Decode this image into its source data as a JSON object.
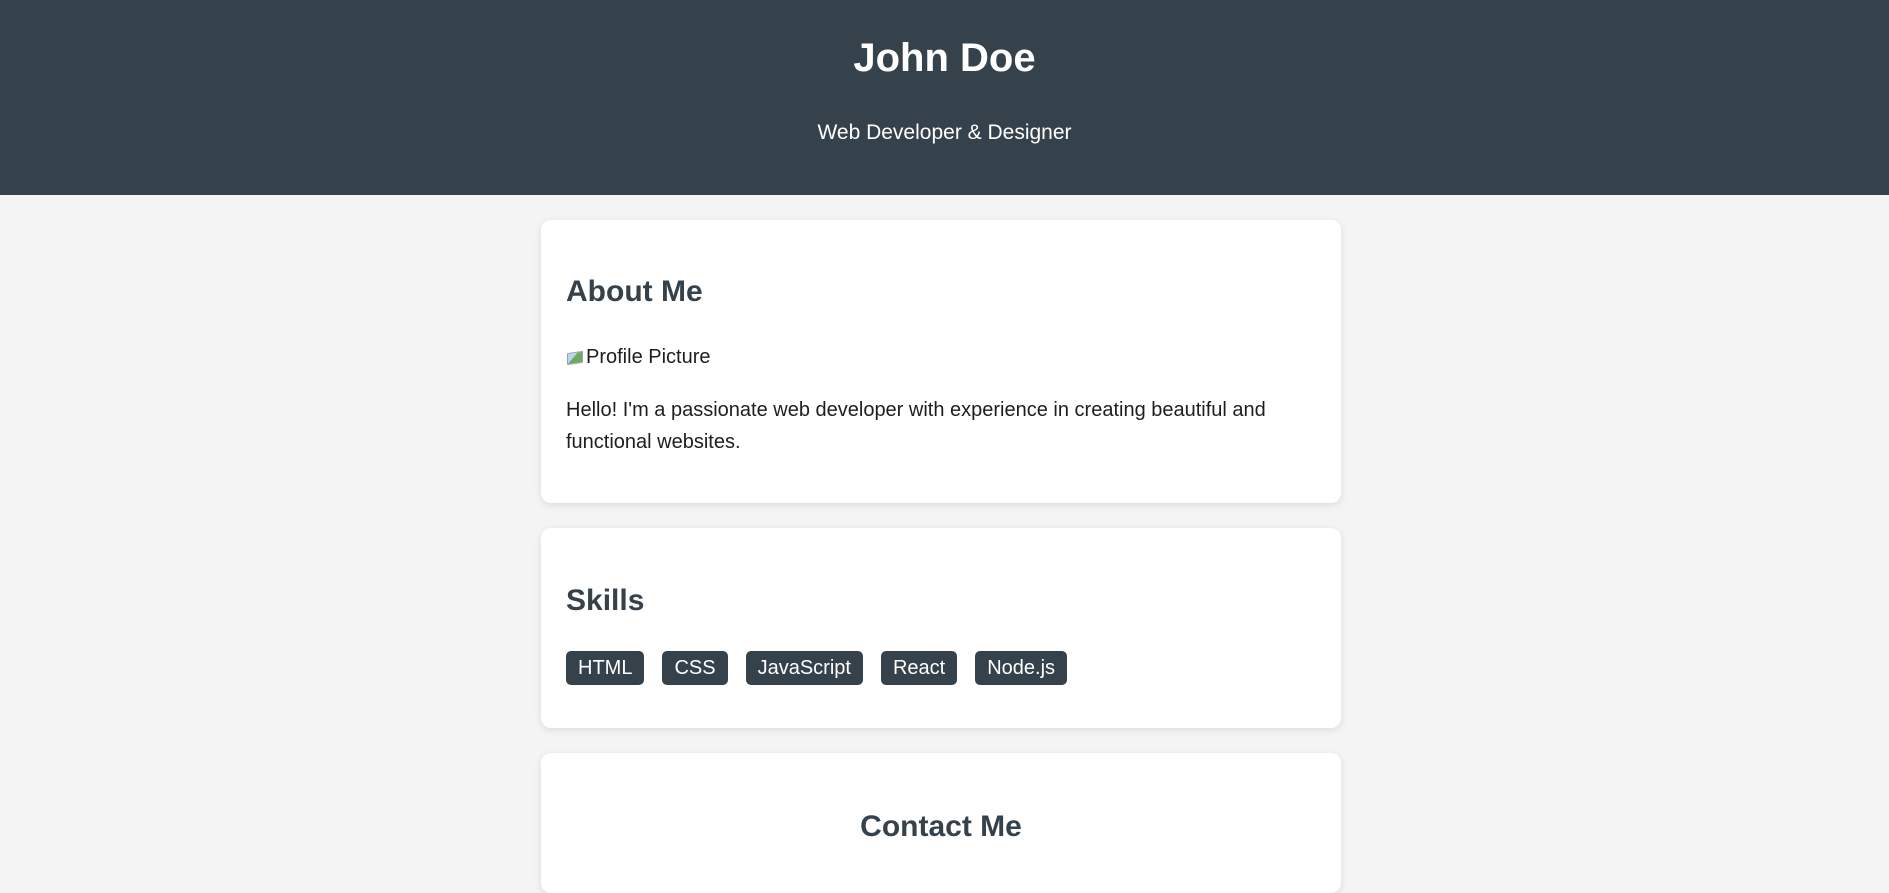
{
  "header": {
    "name": "John Doe",
    "subtitle": "Web Developer & Designer"
  },
  "about": {
    "title": "About Me",
    "profile_alt": "Profile Picture",
    "text": "Hello! I'm a passionate web developer with experience in creating beautiful and functional websites."
  },
  "skills": {
    "title": "Skills",
    "items": [
      "HTML",
      "CSS",
      "JavaScript",
      "React",
      "Node.js"
    ]
  },
  "contact": {
    "title": "Contact Me"
  },
  "colors": {
    "header_bg": "#36424b",
    "page_bg": "#f4f4f4",
    "accent": "#36424b"
  }
}
